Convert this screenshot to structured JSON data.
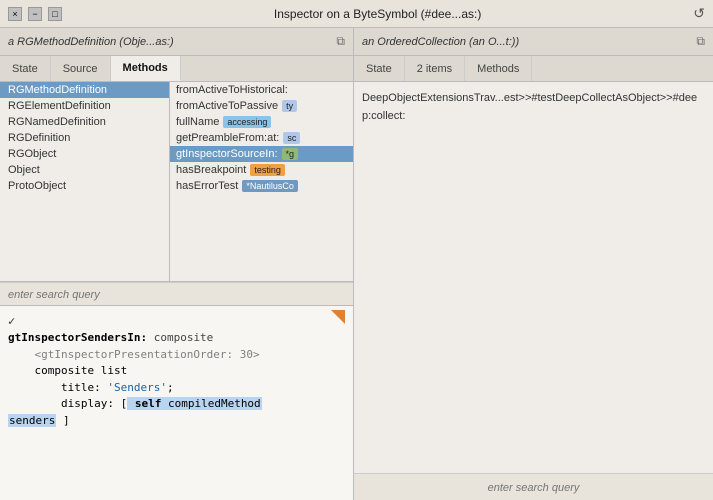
{
  "titleBar": {
    "title": "Inspector on a ByteSymbol (#dee...as:)",
    "controls": [
      "close",
      "minimize",
      "maximize"
    ],
    "close_label": "×",
    "minimize_label": "−",
    "maximize_label": "□",
    "refresh_label": "↺"
  },
  "leftPanel": {
    "header": "a RGMethodDefinition (Obje...as:)",
    "tabs": [
      {
        "label": "State",
        "active": false
      },
      {
        "label": "Source",
        "active": false
      },
      {
        "label": "Methods",
        "active": true
      }
    ],
    "classList": [
      {
        "label": "RGMethodDefinition",
        "selected": true
      },
      {
        "label": "RGElementDefinition",
        "selected": false
      },
      {
        "label": "RGNamedDefinition",
        "selected": false
      },
      {
        "label": "RGDefinition",
        "selected": false
      },
      {
        "label": "RGObject",
        "selected": false
      },
      {
        "label": "Object",
        "selected": false
      },
      {
        "label": "ProtoObject",
        "selected": false
      }
    ],
    "methodList": [
      {
        "label": "fromActiveToHistorical:",
        "badge": null,
        "badgeType": null,
        "truncated": true
      },
      {
        "label": "fromActiveToPassive",
        "badge": "ty",
        "badgeType": "sc"
      },
      {
        "label": "fullName",
        "badge": "accessing",
        "badgeType": "accessing"
      },
      {
        "label": "getPreambleFrom:at:",
        "badge": "sc",
        "badgeType": "sc"
      },
      {
        "label": "gtInspectorSourceIn:",
        "badge": "*g",
        "badgeType": "g",
        "selected": true
      },
      {
        "label": "hasBreakpoint",
        "badge": "testing",
        "badgeType": "testing"
      },
      {
        "label": "hasErrorTest",
        "badge": "*NautilusCo",
        "badgeType": "nautilus"
      }
    ],
    "searchPlaceholder": "enter search query",
    "code": {
      "checkmark": "✓",
      "lines": [
        {
          "text": "gtInspectorSendersIn: composite",
          "type": "method-def"
        },
        {
          "text": "\t<gtInspectorPresentationOrder: 30>",
          "type": "tag"
        },
        {
          "text": "\tcomposite list",
          "type": "normal"
        },
        {
          "text": "\t\ttitle: 'Senders';",
          "type": "normal"
        },
        {
          "text": "\t\tdisplay: [ self compiledMethod",
          "type": "highlight"
        },
        {
          "text": "senders ]",
          "type": "highlight-end"
        }
      ]
    }
  },
  "rightPanel": {
    "header": "an OrderedCollection (an O...t:))",
    "tabs": [
      {
        "label": "State",
        "active": false
      },
      {
        "label": "2 items",
        "active": false
      },
      {
        "label": "Methods",
        "active": false
      }
    ],
    "content": "DeepObjectExtensionsTrav...est>>#testDeepCollectAsObject>>#deep:collect:",
    "searchPlaceholder": "enter search query"
  }
}
